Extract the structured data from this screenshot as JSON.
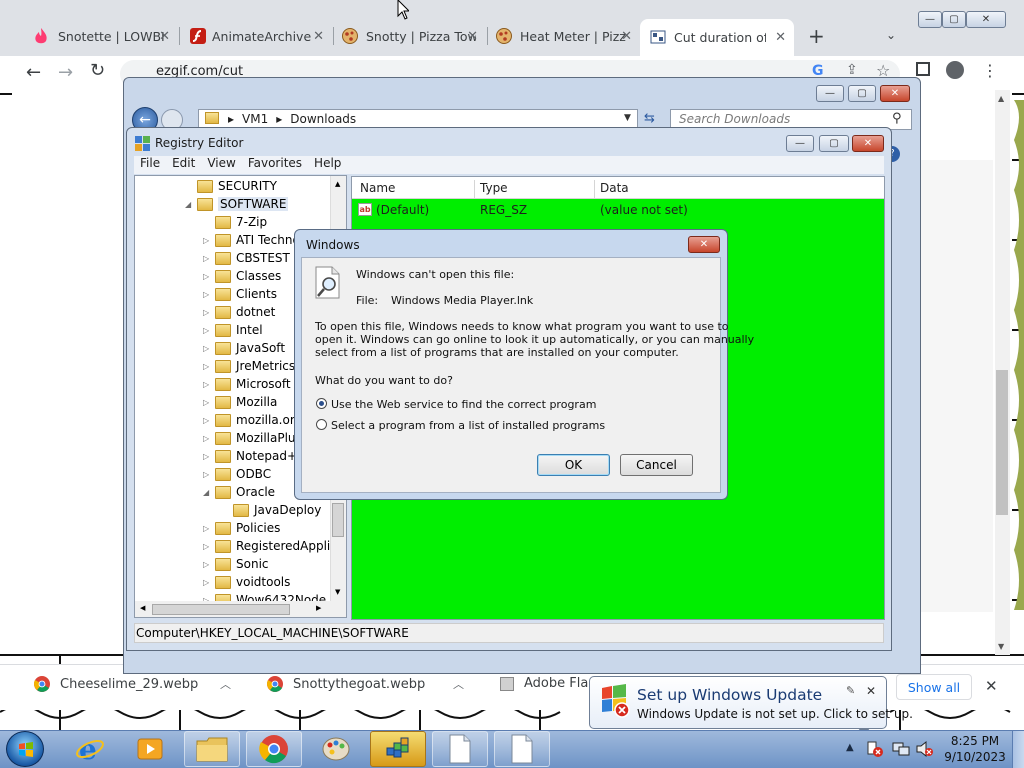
{
  "browser": {
    "tabs": [
      {
        "title": "Snotette | LOWBI",
        "icon": "tinder-flame-icon"
      },
      {
        "title": "AnimateArchive",
        "icon": "flash-icon"
      },
      {
        "title": "Snotty | Pizza Tow",
        "icon": "pizza-icon"
      },
      {
        "title": "Heat Meter | Pizz",
        "icon": "pizza-icon"
      },
      {
        "title": "Cut duration of a",
        "icon": "ezgif-icon"
      }
    ],
    "new_tab": "+",
    "url": "ezgif.com/cut",
    "downloads": [
      {
        "name": "Cheeselime_29.webp",
        "icon": "chrome-icon"
      },
      {
        "name": "Snottythegoat.webp",
        "icon": "chrome-icon"
      },
      {
        "name": "Adobe Fla",
        "icon": "file-icon"
      }
    ],
    "show_all": "Show all"
  },
  "explorer": {
    "breadcrumb": [
      "VM1",
      "Downloads"
    ],
    "search_placeholder": "Search Downloads"
  },
  "regedit": {
    "title": "Registry Editor",
    "menu": [
      "File",
      "Edit",
      "View",
      "Favorites",
      "Help"
    ],
    "tree": [
      {
        "label": "SECURITY",
        "depth": 0,
        "exp": ""
      },
      {
        "label": "SOFTWARE",
        "depth": 0,
        "exp": "open",
        "selected": true
      },
      {
        "label": "7-Zip",
        "depth": 1,
        "exp": ""
      },
      {
        "label": "ATI Techno",
        "depth": 1,
        "exp": "closed"
      },
      {
        "label": "CBSTEST",
        "depth": 1,
        "exp": "closed"
      },
      {
        "label": "Classes",
        "depth": 1,
        "exp": "closed"
      },
      {
        "label": "Clients",
        "depth": 1,
        "exp": "closed"
      },
      {
        "label": "dotnet",
        "depth": 1,
        "exp": "closed"
      },
      {
        "label": "Intel",
        "depth": 1,
        "exp": "closed"
      },
      {
        "label": "JavaSoft",
        "depth": 1,
        "exp": "closed"
      },
      {
        "label": "JreMetrics",
        "depth": 1,
        "exp": "closed"
      },
      {
        "label": "Microsoft",
        "depth": 1,
        "exp": "closed"
      },
      {
        "label": "Mozilla",
        "depth": 1,
        "exp": "closed"
      },
      {
        "label": "mozilla.org",
        "depth": 1,
        "exp": "closed"
      },
      {
        "label": "MozillaPlug",
        "depth": 1,
        "exp": "closed"
      },
      {
        "label": "Notepad++",
        "depth": 1,
        "exp": "closed"
      },
      {
        "label": "ODBC",
        "depth": 1,
        "exp": "closed"
      },
      {
        "label": "Oracle",
        "depth": 1,
        "exp": "open"
      },
      {
        "label": "JavaDeploy",
        "depth": 2,
        "exp": ""
      },
      {
        "label": "Policies",
        "depth": 1,
        "exp": "closed"
      },
      {
        "label": "RegisteredApplica",
        "depth": 1,
        "exp": "closed"
      },
      {
        "label": "Sonic",
        "depth": 1,
        "exp": "closed"
      },
      {
        "label": "voidtools",
        "depth": 1,
        "exp": "closed"
      },
      {
        "label": "Wow6432Node",
        "depth": 1,
        "exp": "closed"
      }
    ],
    "columns": [
      "Name",
      "Type",
      "Data"
    ],
    "rows": [
      {
        "name": "(Default)",
        "type": "REG_SZ",
        "data": "(value not set)"
      }
    ],
    "status": "Computer\\HKEY_LOCAL_MACHINE\\SOFTWARE"
  },
  "dialog": {
    "title": "Windows",
    "heading": "Windows can't open this file:",
    "file_label": "File:",
    "file_name": "Windows Media Player.lnk",
    "body_lines": [
      "To open this file, Windows needs to know what program you want to use to",
      "open it. Windows can go online to look it up automatically, or you can manually",
      "select from a list of programs that are installed on your computer."
    ],
    "question": "What do you want to do?",
    "options": [
      {
        "label": "Use the Web service to find the correct program",
        "checked": true
      },
      {
        "label": "Select a program from a list of installed programs",
        "checked": false
      }
    ],
    "ok": "OK",
    "cancel": "Cancel"
  },
  "notification": {
    "title": "Set up Windows Update",
    "body": "Windows Update is not set up. Click to set up."
  },
  "taskbar": {
    "time": "8:25 PM",
    "date": "9/10/2023"
  }
}
